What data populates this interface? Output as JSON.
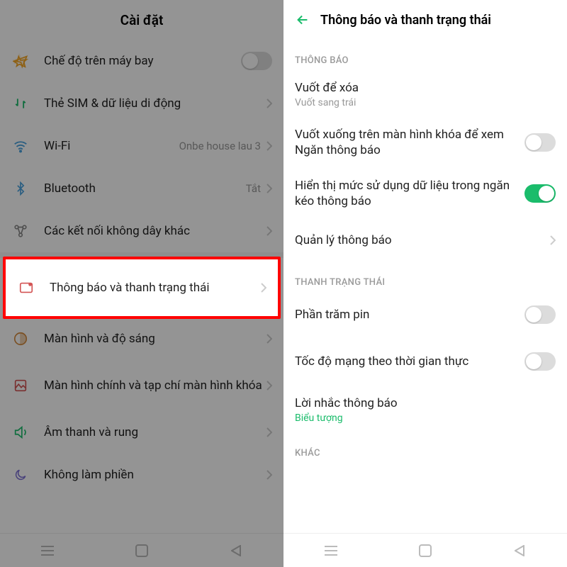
{
  "left": {
    "title": "Cài đặt",
    "items": {
      "airplane": {
        "label": "Chế độ trên máy bay",
        "toggle": false
      },
      "sim": {
        "label": "Thẻ SIM & dữ liệu di động"
      },
      "wifi": {
        "label": "Wi-Fi",
        "value": "Onbe house lau 3"
      },
      "bluetooth": {
        "label": "Bluetooth",
        "value": "Tắt"
      },
      "wireless": {
        "label": "Các kết nối không dây khác"
      },
      "notif": {
        "label": "Thông báo và thanh trạng thái"
      },
      "display": {
        "label": "Màn hình và độ sáng"
      },
      "home": {
        "label": "Màn hình chính và tạp chí màn hình khóa"
      },
      "sound": {
        "label": "Âm thanh và rung"
      },
      "dnd": {
        "label": "Không làm phiền"
      }
    }
  },
  "right": {
    "title": "Thông báo và thanh trạng thái",
    "sections": {
      "s1": "THÔNG BÁO",
      "s2": "THANH TRẠNG THÁI",
      "s3": "KHÁC"
    },
    "items": {
      "swipe": {
        "label": "Vuốt để xóa",
        "sub": "Vuốt sang trái"
      },
      "lockswipe": {
        "label": "Vuốt xuống trên màn hình khóa để xem Ngăn thông báo",
        "toggle": false
      },
      "datausage": {
        "label": "Hiển thị mức sử dụng dữ liệu trong ngăn kéo thông báo",
        "toggle": true
      },
      "manage": {
        "label": "Quản lý thông báo"
      },
      "battery": {
        "label": "Phần trăm pin",
        "toggle": false
      },
      "netspeed": {
        "label": "Tốc độ mạng theo thời gian thực",
        "toggle": false
      },
      "reminder": {
        "label": "Lời nhắc thông báo",
        "sub": "Biểu tượng"
      }
    }
  }
}
